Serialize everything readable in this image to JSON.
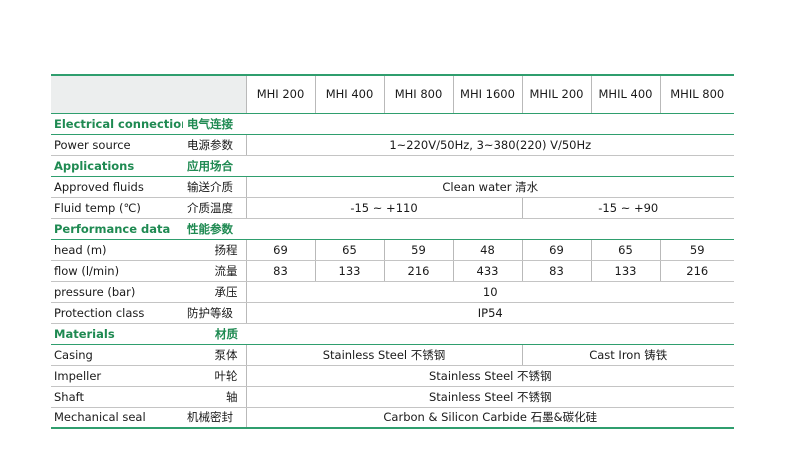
{
  "models": [
    "MHI 200",
    "MHI 400",
    "MHI 800",
    "MHI 1600",
    "MHIL 200",
    "MHIL 400",
    "MHIL 800"
  ],
  "sections": {
    "electrical": {
      "en": "Electrical connection",
      "cn": "电气连接"
    },
    "applications": {
      "en": "Applications",
      "cn": "应用场合"
    },
    "performance": {
      "en": "Performance data",
      "cn": "性能参数"
    },
    "materials": {
      "en": "Materials",
      "cn": "材质"
    }
  },
  "rows": {
    "power_source": {
      "en": "Power source",
      "cn": "电源参数",
      "value": "1~220V/50Hz, 3~380(220) V/50Hz"
    },
    "approved_fluids": {
      "en": "Approved fluids",
      "cn": "输送介质",
      "value": "Clean water  清水"
    },
    "fluid_temp": {
      "en": "Fluid temp (℃)",
      "cn": "介质温度",
      "value_mhi": "-15 ~ +110",
      "value_mhil": "-15 ~ +90"
    },
    "head": {
      "en": "head (m)",
      "cn": "扬程",
      "values": [
        "69",
        "65",
        "59",
        "48",
        "69",
        "65",
        "59"
      ]
    },
    "flow": {
      "en": "flow (l/min)",
      "cn": "流量",
      "values": [
        "83",
        "133",
        "216",
        "433",
        "83",
        "133",
        "216"
      ]
    },
    "pressure": {
      "en": "pressure (bar)",
      "cn": "承压",
      "value": "10"
    },
    "protection": {
      "en": "Protection class",
      "cn": "防护等级",
      "value": "IP54"
    },
    "casing": {
      "en": "Casing",
      "cn": "泵体",
      "value_mhi": "Stainless Steel  不锈钢",
      "value_mhil": "Cast Iron  铸铁"
    },
    "impeller": {
      "en": "Impeller",
      "cn": "叶轮",
      "value": "Stainless Steel  不锈钢"
    },
    "shaft": {
      "en": "Shaft",
      "cn": "轴",
      "value": "Stainless Steel  不锈钢"
    },
    "seal": {
      "en": "Mechanical seal",
      "cn": "机械密封",
      "value": "Carbon & Silicon Carbide  石墨&碳化硅"
    }
  }
}
